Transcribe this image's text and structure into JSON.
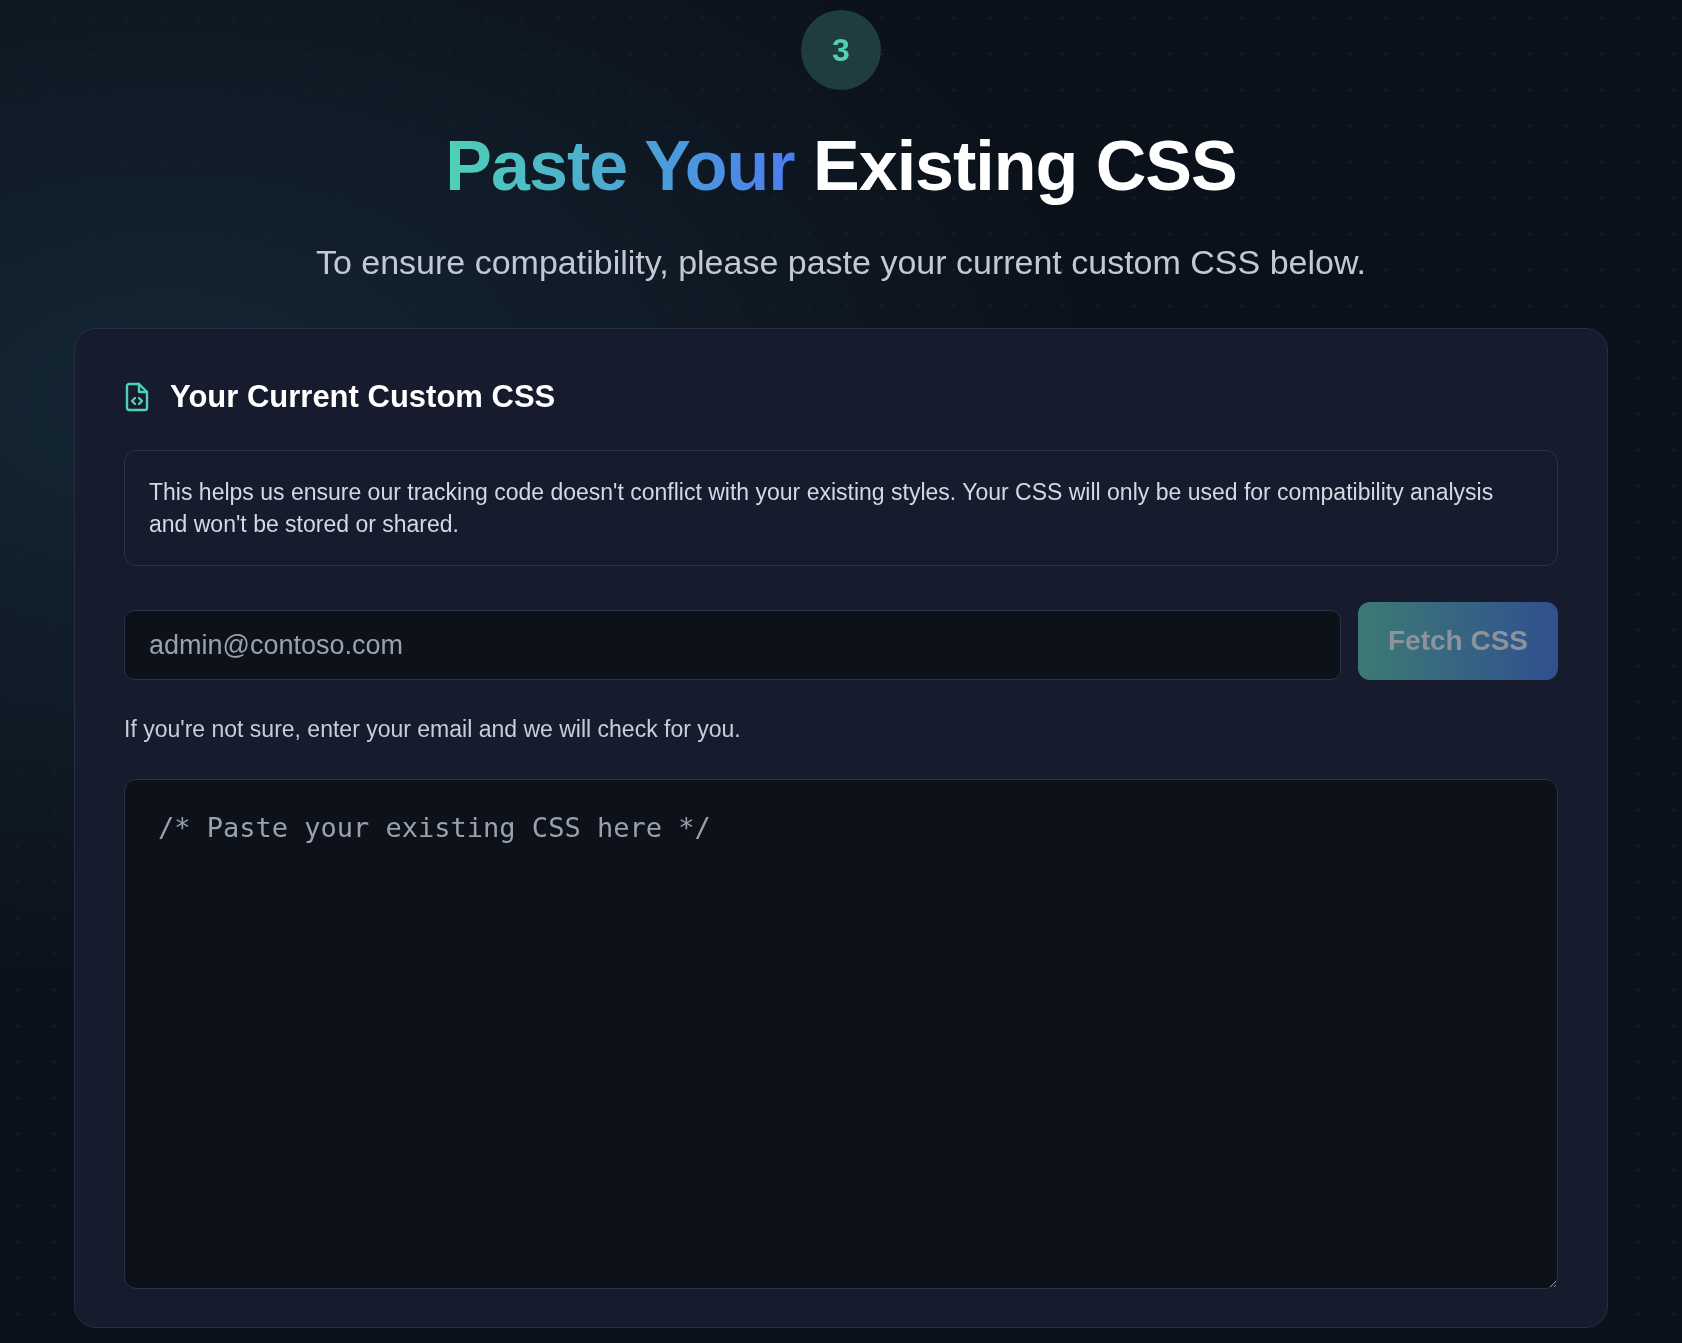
{
  "step": {
    "number": "3"
  },
  "title": {
    "parts": [
      {
        "text": "Paste Your",
        "kind": "gradient"
      },
      {
        "text": "Existing CSS",
        "kind": "plain"
      }
    ]
  },
  "subtitle": "To ensure compatibility, please paste your current custom CSS below.",
  "card": {
    "heading": "Your Current Custom CSS",
    "info": "This helps us ensure our tracking code doesn't conflict with your existing styles. Your CSS will only be used for compatibility analysis and won't be stored or shared.",
    "email_field": {
      "placeholder": "admin@contoso.com"
    },
    "fetch_button": {
      "label": "Fetch CSS",
      "disabled": true
    },
    "hint": "If you're not sure, enter your email and we will check for you.",
    "css_editor": {
      "placeholder": "/* Paste your existing CSS here */"
    }
  }
}
